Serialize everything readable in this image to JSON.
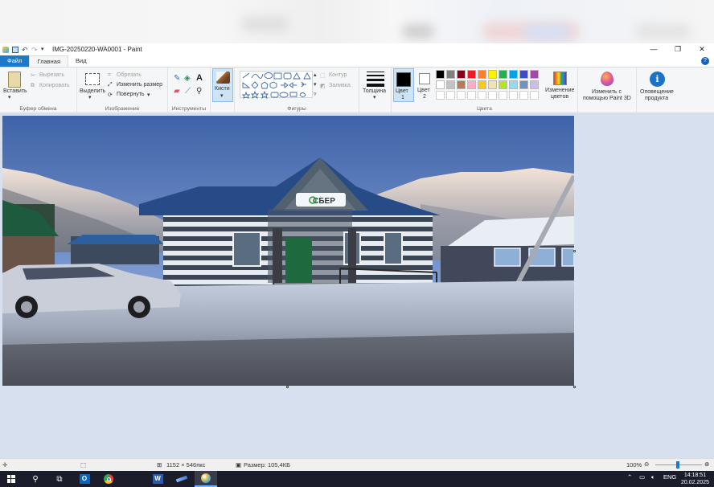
{
  "window": {
    "title": "IMG-20250220-WA0001 - Paint"
  },
  "tabs": [
    {
      "label": "Файл"
    },
    {
      "label": "Главная"
    },
    {
      "label": "Вид"
    }
  ],
  "ribbon": {
    "clipboard": {
      "paste": "Вставить",
      "cut": "Вырезать",
      "copy": "Копировать",
      "group": "Буфер обмена"
    },
    "image": {
      "select": "Выделить",
      "crop": "Обрезать",
      "resize": "Изменить размер",
      "rotate": "Повернуть",
      "group": "Изображение"
    },
    "tools": {
      "group": "Инструменты"
    },
    "brushes": {
      "label": "Кисти"
    },
    "shapes": {
      "outline": "Контур",
      "fill": "Заливка",
      "group": "Фигуры"
    },
    "size": {
      "label": "Толщина"
    },
    "colors": {
      "color1_line1": "Цвет",
      "color1_line2": "1",
      "color2_line1": "Цвет",
      "color2_line2": "2",
      "edit_line1": "Изменение",
      "edit_line2": "цветов",
      "group": "Цвета",
      "color1": "#000000",
      "color2": "#ffffff",
      "palette_row1": [
        "#000000",
        "#7f7f7f",
        "#880015",
        "#ed1c24",
        "#ff7f27",
        "#fff200",
        "#22b14c",
        "#00a2e8",
        "#3f48cc",
        "#a349a4"
      ],
      "palette_row2": [
        "#ffffff",
        "#c3c3c3",
        "#b97a57",
        "#ffaec9",
        "#ffc90e",
        "#efe4b0",
        "#b5e61d",
        "#99d9ea",
        "#7092be",
        "#c8bfe7"
      ]
    },
    "paint3d": {
      "line1": "Изменить с",
      "line2": "помощью Paint 3D"
    },
    "notification": {
      "line1": "Оповещение",
      "line2": "продукта"
    }
  },
  "photo": {
    "sign_text": "СБЕР"
  },
  "statusbar": {
    "dimensions": "1152 × 546пкс",
    "size": "Размер: 105,4КБ",
    "zoom": "100%"
  },
  "taskbar": {
    "lang": "ENG",
    "time": "14:18:51",
    "date": "20.02.2025"
  }
}
